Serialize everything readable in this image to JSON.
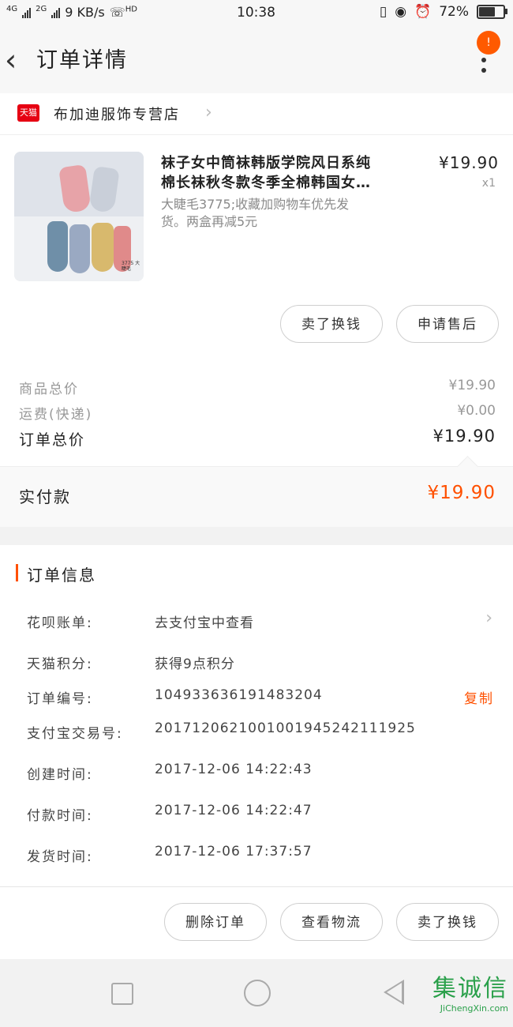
{
  "status_bar": {
    "network1": "4G",
    "network2": "2G",
    "speed": "9 KB/s",
    "hd": "HD",
    "time": "10:38",
    "battery": "72%",
    "battery_level": 0.72
  },
  "header": {
    "title": "订单详情",
    "badge": "!"
  },
  "store": {
    "platform_badge": "天猫",
    "name": "布加迪服饰专营店"
  },
  "product": {
    "title_line1": "袜子女中筒袜韩版学院风日系纯",
    "title_line2": "棉长袜秋冬款冬季全棉韩国女…",
    "spec_line1": "大睫毛3775;收藏加购物车优先发",
    "spec_line2": "货。两盒再减5元",
    "price": "¥19.90",
    "quantity": "x1",
    "image_caption": "3775 大睫毛"
  },
  "item_actions": {
    "sell_button": "卖了换钱",
    "aftersale_button": "申请售后"
  },
  "summary": {
    "goods_total_label": "商品总价",
    "goods_total_value": "¥19.90",
    "shipping_label": "运费(快递)",
    "shipping_value": "¥0.00",
    "order_total_label": "订单总价",
    "order_total_value": "¥19.90",
    "paid_label": "实付款",
    "paid_value": "¥19.90"
  },
  "order_info": {
    "heading": "订单信息",
    "rows": [
      {
        "label": "花呗账单:",
        "value": "去支付宝中查看"
      },
      {
        "label": "天猫积分:",
        "value": "获得9点积分"
      },
      {
        "label": "订单编号:",
        "value": "104933636191483204"
      },
      {
        "label": "支付宝交易号:",
        "value": "2017120621001001945242111925"
      },
      {
        "label": "创建时间:",
        "value": "2017-12-06 14:22:43"
      },
      {
        "label": "付款时间:",
        "value": "2017-12-06 14:22:47"
      },
      {
        "label": "发货时间:",
        "value": "2017-12-06 17:37:57"
      }
    ],
    "copy_label": "复制"
  },
  "bottom_actions": {
    "delete_button": "删除订单",
    "logistics_button": "查看物流",
    "sell_button": "卖了换钱"
  },
  "watermark": {
    "cn": "集诚信",
    "en": "JiChengXin.com"
  },
  "colors": {
    "accent": "#ff5000",
    "tmall_red": "#e60012",
    "watermark_green": "#2aa04a"
  }
}
